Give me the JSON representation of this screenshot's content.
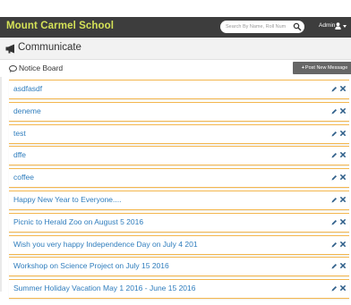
{
  "topbar": {
    "brand": "Mount Carmel School",
    "search_placeholder": "Search By Name, Roll Num",
    "admin_label": "Admin",
    "background_color": "#3d3d3d",
    "brand_color": "#d4e157"
  },
  "header": {
    "title": "Communicate",
    "icon": "megaphone-icon"
  },
  "panel": {
    "title": "Notice Board",
    "post_button_label": "Post New Message"
  },
  "notices": [
    {
      "title": "asdfasdf"
    },
    {
      "title": "deneme"
    },
    {
      "title": "test"
    },
    {
      "title": "dffe"
    },
    {
      "title": "coffee"
    },
    {
      "title": "Happy New Year to Everyone...."
    },
    {
      "title": "Picnic to Herald Zoo on August 5 2016"
    },
    {
      "title": "Wish you very happy Independence Day on July 4 201"
    },
    {
      "title": "Workshop on Science Project on July 15 2016"
    },
    {
      "title": "Summer Holiday Vacation May 1 2016 - June 15 2016"
    }
  ],
  "colors": {
    "accent_border": "#f3b64d",
    "link": "#2f7dbd"
  }
}
